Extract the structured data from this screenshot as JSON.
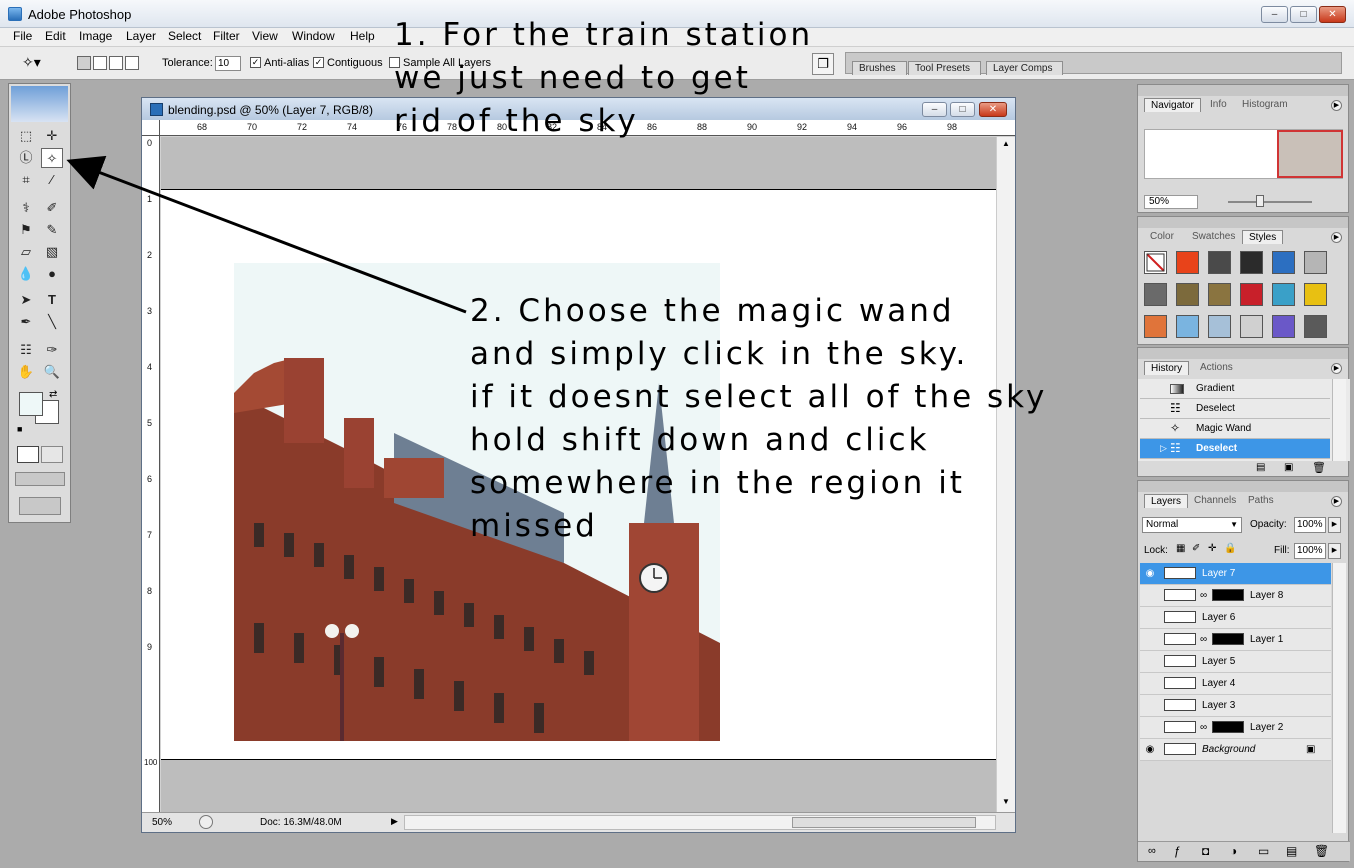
{
  "window": {
    "title": "Adobe Photoshop"
  },
  "menu": [
    "File",
    "Edit",
    "Image",
    "Layer",
    "Select",
    "Filter",
    "View",
    "Window",
    "Help"
  ],
  "options_bar": {
    "tolerance_label": "Tolerance:",
    "tolerance_value": "10",
    "anti_alias_label": "Anti-alias",
    "contiguous_label": "Contiguous",
    "sample_all_layers_label": "Sample All Layers"
  },
  "palette_well": [
    "Brushes",
    "Tool Presets",
    "Layer Comps"
  ],
  "document": {
    "title": "blending.psd @ 50% (Layer 7, RGB/8)",
    "ruler_top": [
      "68",
      "70",
      "72",
      "74",
      "76",
      "78",
      "80",
      "82",
      "84",
      "86",
      "88",
      "90",
      "92",
      "94",
      "96",
      "98"
    ],
    "ruler_left": [
      "0",
      "1",
      "2",
      "3",
      "4",
      "5",
      "6",
      "7",
      "8",
      "9",
      "100"
    ],
    "zoom": "50%",
    "doc_size": "Doc: 16.3M/48.0M"
  },
  "navigator_panel": {
    "tabs": [
      "Navigator",
      "Info",
      "Histogram"
    ],
    "zoom": "50%"
  },
  "styles_panel": {
    "tabs": [
      "Color",
      "Swatches",
      "Styles"
    ],
    "swatch_colors": [
      "#ffffff",
      "#e8431a",
      "#4a4a4a",
      "#2b2b2b",
      "#2c6fc1",
      "#b5b5b5",
      "#6a6a6a",
      "#7c6a3c",
      "#8a7440",
      "#c8202a",
      "#3aa0c8",
      "#e8c012",
      "#e0743a",
      "#7ab4e0",
      "#a6c0d8",
      "#d0d0d0",
      "#6a58c8",
      "#5a5a5a"
    ]
  },
  "history_panel": {
    "tabs": [
      "History",
      "Actions"
    ],
    "items": [
      {
        "name": "Gradient",
        "selected": false
      },
      {
        "name": "Deselect",
        "selected": false
      },
      {
        "name": "Magic Wand",
        "selected": false
      },
      {
        "name": "Deselect",
        "selected": true
      }
    ]
  },
  "layers_panel": {
    "tabs": [
      "Layers",
      "Channels",
      "Paths"
    ],
    "blend_mode": "Normal",
    "opacity_label": "Opacity:",
    "opacity": "100%",
    "lock_label": "Lock:",
    "fill_label": "Fill:",
    "fill": "100%",
    "layers": [
      {
        "name": "Layer 7",
        "visible": true,
        "selected": true,
        "mask": false
      },
      {
        "name": "Layer 8",
        "visible": false,
        "selected": false,
        "mask": true
      },
      {
        "name": "Layer 6",
        "visible": false,
        "selected": false,
        "mask": false
      },
      {
        "name": "Layer 1",
        "visible": false,
        "selected": false,
        "mask": true
      },
      {
        "name": "Layer 5",
        "visible": false,
        "selected": false,
        "mask": false
      },
      {
        "name": "Layer 4",
        "visible": false,
        "selected": false,
        "mask": false
      },
      {
        "name": "Layer 3",
        "visible": false,
        "selected": false,
        "mask": false
      },
      {
        "name": "Layer 2",
        "visible": false,
        "selected": false,
        "mask": true
      },
      {
        "name": "Background",
        "visible": true,
        "selected": false,
        "mask": false
      }
    ]
  },
  "annotations": {
    "note1": [
      "1. For the train station",
      "we just need to get",
      "rid of the sky"
    ],
    "note2": [
      "2. Choose the magic wand",
      "and simply click in the sky.",
      "if it doesnt select all of the sky",
      "hold shift down and click",
      "somewhere in the region it",
      "missed"
    ]
  },
  "colors": {
    "selection_blue": "#3d96e7",
    "workspace_gray": "#ababab"
  }
}
